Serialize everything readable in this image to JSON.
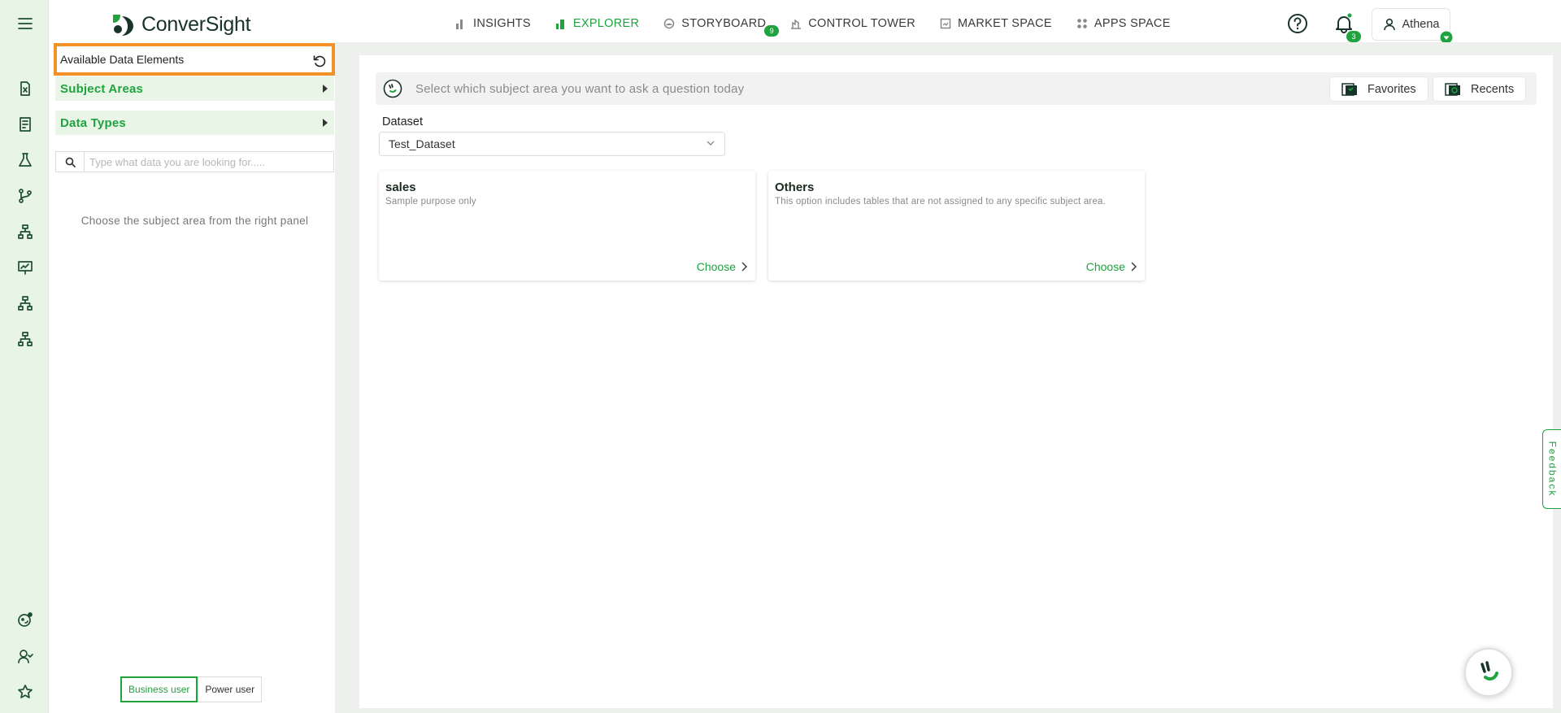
{
  "brand": {
    "name": "ConverSight",
    "accent": "#1ea33f",
    "dark": "#17332a",
    "highlight": "#f39026"
  },
  "nav": {
    "items": [
      {
        "label": "INSIGHTS",
        "icon": "bar-chart-icon",
        "active": false
      },
      {
        "label": "EXPLORER",
        "icon": "explorer-chart-icon",
        "active": true
      },
      {
        "label": "STORYBOARD",
        "icon": "storyboard-icon",
        "active": false,
        "badge": "9"
      },
      {
        "label": "CONTROL TOWER",
        "icon": "control-tower-icon",
        "active": false
      },
      {
        "label": "MARKET SPACE",
        "icon": "market-space-icon",
        "active": false
      },
      {
        "label": "APPS SPACE",
        "icon": "apps-grid-icon",
        "active": false
      }
    ]
  },
  "header": {
    "notifications_count": "3",
    "user_name": "Athena"
  },
  "left_panel": {
    "title": "Available Data Elements",
    "subject_areas_label": "Subject Areas",
    "data_types_label": "Data Types",
    "search_placeholder": "Type what data you are looking for.....",
    "hint": "Choose the subject area from the right panel",
    "modes": [
      {
        "label": "Business user",
        "active": true
      },
      {
        "label": "Power user",
        "active": false
      }
    ]
  },
  "main": {
    "ask_placeholder": "Select which subject area you want to ask a question today",
    "favorites_label": "Favorites",
    "recents_label": "Recents",
    "dataset_label": "Dataset",
    "dataset_value": "Test_Dataset",
    "cards": [
      {
        "title": "sales",
        "description": "Sample purpose only",
        "action": "Choose"
      },
      {
        "title": "Others",
        "description": "This option includes tables that are not assigned to any specific subject area.",
        "action": "Choose"
      }
    ]
  },
  "feedback_label": "Feedback"
}
